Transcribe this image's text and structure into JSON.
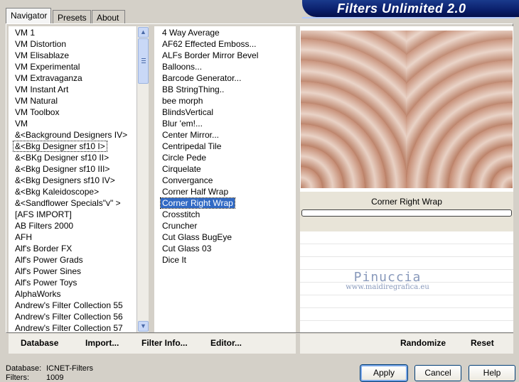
{
  "header": {
    "title": "Filters Unlimited 2.0"
  },
  "tabs": [
    {
      "label": "Navigator"
    },
    {
      "label": "Presets"
    },
    {
      "label": "About"
    }
  ],
  "categories": {
    "items": [
      "VM 1",
      "VM Distortion",
      "VM Elisablaze",
      "VM Experimental",
      "VM Extravaganza",
      "VM Instant Art",
      "VM Natural",
      "VM Toolbox",
      "VM",
      "&<Background Designers IV>",
      "&<Bkg Designer sf10 I>",
      "&<BKg Designer sf10 II>",
      "&<Bkg Designer sf10 III>",
      "&<Bkg Designers sf10 IV>",
      "&<Bkg Kaleidoscope>",
      "&<Sandflower Specials\"v\" >",
      "[AFS IMPORT]",
      "AB Filters 2000",
      "AFH",
      "Alf's Border FX",
      "Alf's Power Grads",
      "Alf's Power Sines",
      "Alf's Power Toys",
      "AlphaWorks",
      "Andrew's Filter Collection 55",
      "Andrew's Filter Collection 56",
      "Andrew's Filter Collection 57"
    ],
    "focused_index": 10
  },
  "filters": {
    "items": [
      "4 Way Average",
      "AF62 Effected Emboss...",
      "ALFs Border Mirror Bevel",
      "Balloons...",
      "Barcode Generator...",
      "BB StringThing..",
      "bee morph",
      "BlindsVertical",
      "Blur 'em!...",
      "Center Mirror...",
      "Centripedal Tile",
      "Circle Pede",
      "Cirquelate",
      "Convergance",
      "Corner Half Wrap",
      "Corner Right Wrap",
      "Crosstitch",
      "Cruncher",
      "Cut Glass  BugEye",
      "Cut Glass 03",
      "Dice It"
    ],
    "selected_index": 15
  },
  "preview": {
    "filter_name": "Corner Right Wrap",
    "progress": 0
  },
  "watermark": {
    "line1": "Pinuccia",
    "line2": "www.maidiregrafica.eu"
  },
  "actions": {
    "database": "Database",
    "import": "Import...",
    "filter_info": "Filter Info...",
    "editor": "Editor...",
    "randomize": "Randomize",
    "reset": "Reset"
  },
  "status": {
    "database_label": "Database:",
    "database_value": "ICNET-Filters",
    "filters_label": "Filters:",
    "filters_value": "1009"
  },
  "buttons": {
    "apply": "Apply",
    "cancel": "Cancel",
    "help": "Help"
  }
}
